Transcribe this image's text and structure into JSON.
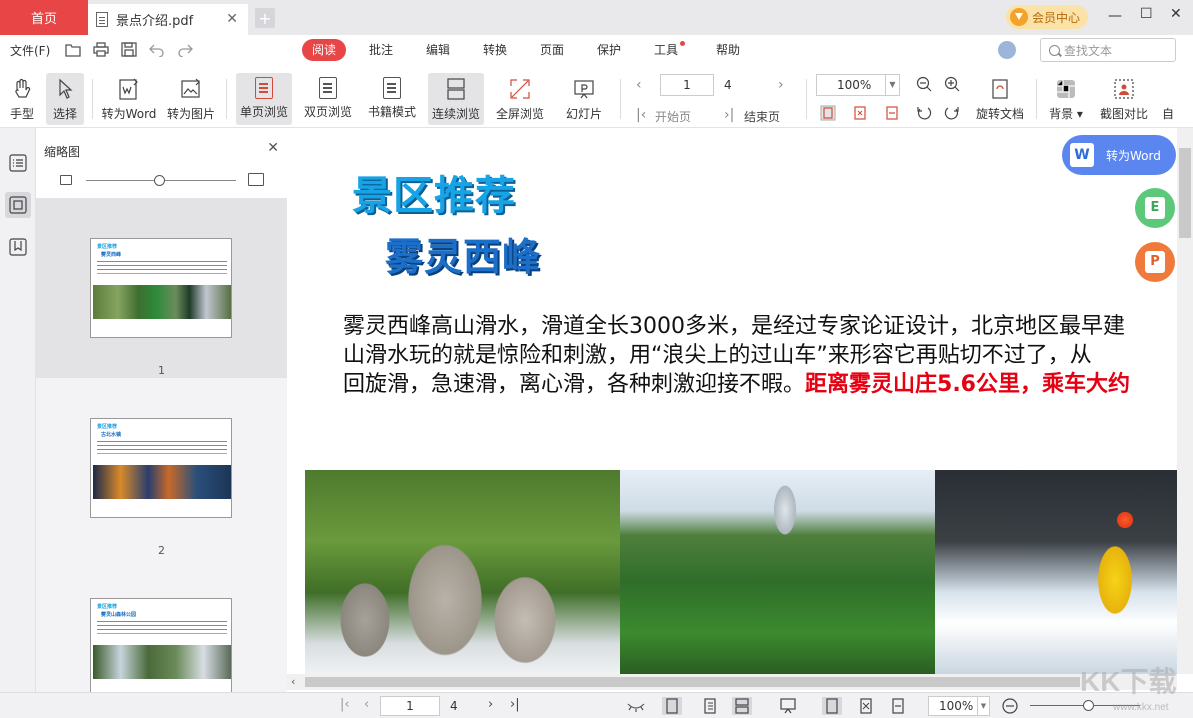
{
  "titlebar": {
    "home_tab": "首页",
    "doc_tab": "景点介绍.pdf",
    "member": "会员中心"
  },
  "menubar": {
    "file": "文件(F)",
    "tabs": [
      "阅读",
      "批注",
      "编辑",
      "转换",
      "页面",
      "保护",
      "工具",
      "帮助"
    ],
    "search_placeholder": "查找文本"
  },
  "toolbar": {
    "hand": "手型",
    "select": "选择",
    "to_word": "转为Word",
    "to_image": "转为图片",
    "single_page": "单页浏览",
    "double_page": "双页浏览",
    "book_mode": "书籍模式",
    "continuous": "连续浏览",
    "fullscreen": "全屏浏览",
    "slideshow": "幻灯片",
    "current_page": "1",
    "total_pages": "4",
    "first_page": "开始页",
    "last_page": "结束页",
    "zoom": "100%",
    "rotate_doc": "旋转文档",
    "background": "背景",
    "screenshot_compare": "截图对比",
    "auto": "自"
  },
  "thumbnails": {
    "title": "缩略图",
    "items": [
      {
        "num": "1",
        "t1": "景区推荐",
        "t2": "雾灵西峰"
      },
      {
        "num": "2",
        "t1": "景区推荐",
        "t2": "古北水镇"
      },
      {
        "num": "3",
        "t1": "景区推荐",
        "t2": "雾灵山森林公园"
      }
    ]
  },
  "document": {
    "heading1": "景区推荐",
    "heading2": "雾灵西峰",
    "line1": "雾灵西峰高山滑水，滑道全长3000多米，是经过专家论证设计，北京地区最早建",
    "line2": "山滑水玩的就是惊险和刺激，用“浪尖上的过山车”来形容它再贴切不过了，从",
    "line3": "回旋滑，急速滑，离心滑，各种刺激迎接不暇。",
    "line3_red": "距离雾灵山庄5.6公里，乘车大约"
  },
  "floating": {
    "to_word": "转为Word",
    "excel_letter": "E",
    "ppt_letter": "P"
  },
  "statusbar": {
    "current_page": "1",
    "total_pages": "4",
    "zoom": "100%"
  },
  "watermark": {
    "logo": "KK下载",
    "url": "www.kkx.net"
  },
  "colors": {
    "accent_red": "#e84646",
    "heading_blue": "#17a4e6",
    "float_blue": "#5b86f0",
    "excel_green": "#5cc87a",
    "ppt_orange": "#f07a3c"
  }
}
